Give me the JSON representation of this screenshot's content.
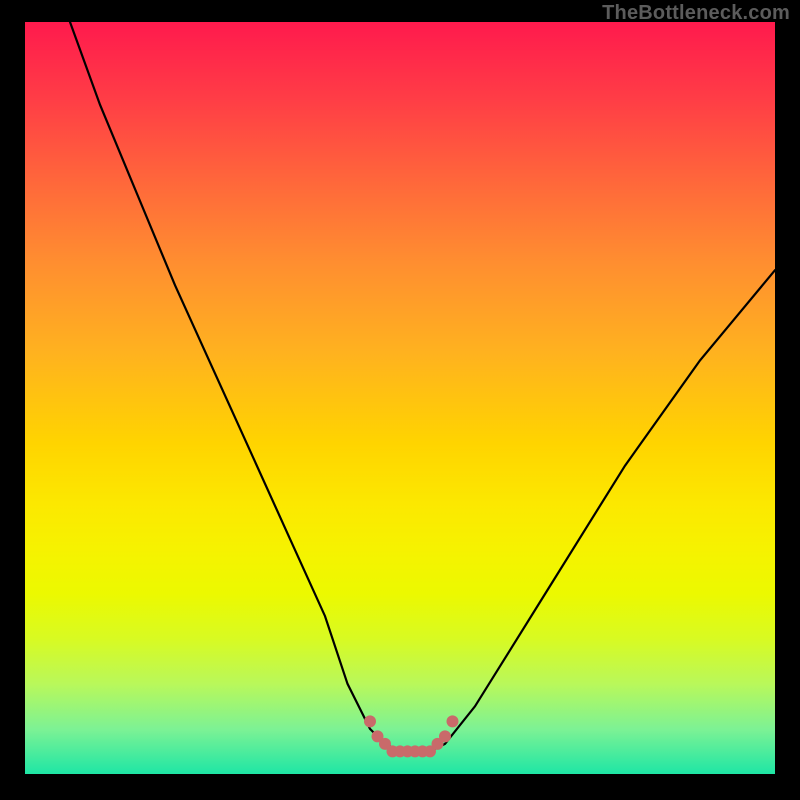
{
  "watermark": "TheBottleneck.com",
  "chart_data": {
    "type": "line",
    "title": "",
    "xlabel": "",
    "ylabel": "",
    "xlim": [
      0,
      100
    ],
    "ylim": [
      0,
      100
    ],
    "grid": false,
    "series": [
      {
        "name": "bottleneck-curve",
        "x": [
          6,
          10,
          15,
          20,
          25,
          30,
          35,
          40,
          43,
          46,
          48,
          50,
          52,
          54,
          56,
          60,
          65,
          70,
          75,
          80,
          85,
          90,
          95,
          100
        ],
        "values": [
          100,
          89,
          77,
          65,
          54,
          43,
          32,
          21,
          12,
          6,
          4,
          3,
          3,
          3,
          4,
          9,
          17,
          25,
          33,
          41,
          48,
          55,
          61,
          67
        ]
      }
    ],
    "markers": {
      "name": "highlight-dots",
      "color": "#c96a6a",
      "x": [
        46,
        47,
        48,
        49,
        50,
        51,
        52,
        53,
        54,
        55,
        56,
        57
      ],
      "values": [
        7,
        5,
        4,
        3,
        3,
        3,
        3,
        3,
        3,
        4,
        5,
        7
      ]
    }
  }
}
